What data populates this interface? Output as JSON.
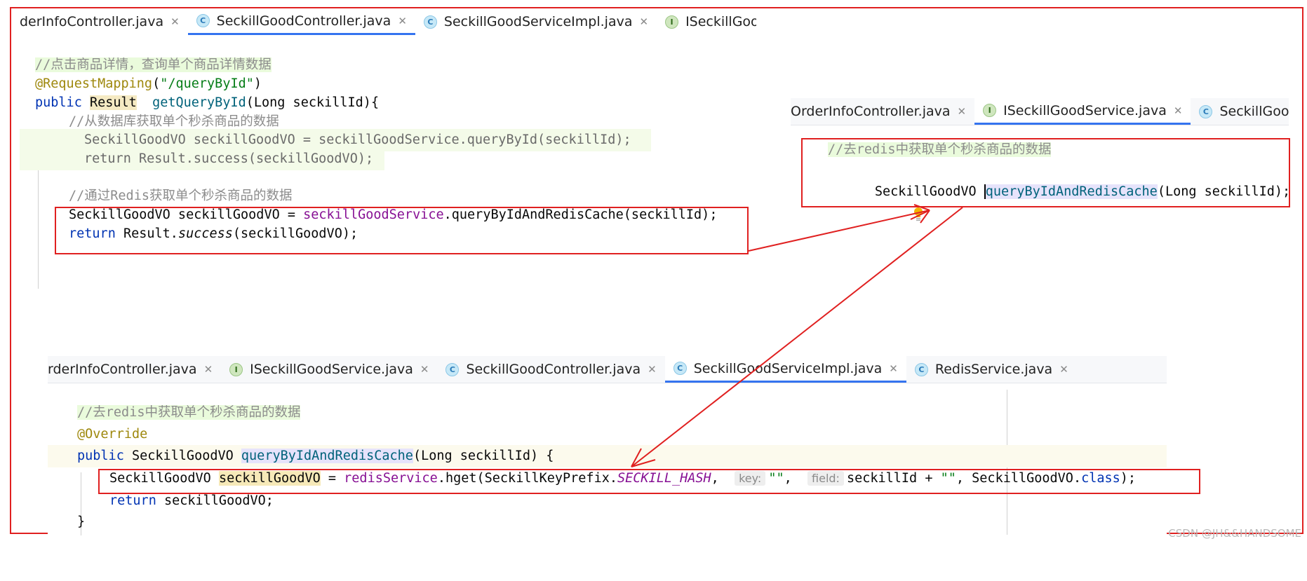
{
  "panel1": {
    "tabs": [
      {
        "label": "derInfoController.java",
        "icon": "class-icon",
        "active": false
      },
      {
        "label": "SeckillGoodController.java",
        "icon": "class-icon",
        "active": true
      },
      {
        "label": "SeckillGoodServiceImpl.java",
        "icon": "class-icon",
        "active": false
      },
      {
        "label": "ISeckillGoodService.j",
        "icon": "interface-icon",
        "active": false
      }
    ],
    "comment1": "//点击商品详情，查询单个商品详情数据",
    "annotation": "@RequestMapping",
    "mapping_path": "\"/queryById\"",
    "kw_public": "public",
    "type_result": "Result",
    "method_name": "getQueryById",
    "params": "(Long seckillId){",
    "comment2": "//从数据库获取单个秒杀商品的数据",
    "line_vo": "SeckillGoodVO seckillGoodVO = seckillGoodService.queryById(seckillId);",
    "line_return1": "return Result.success(seckillGoodVO);",
    "comment3": "//通过Redis获取单个秒杀商品的数据",
    "redis_call_prefix": "SeckillGoodVO seckillGoodVO = ",
    "redis_call_field": "seckillGoodService",
    "redis_call_suffix": ".queryByIdAndRedisCache(seckillId);",
    "kw_return": "return",
    "return_obj": " Result.",
    "return_method": "success",
    "return_args": "(seckillGoodVO);"
  },
  "panel2": {
    "tabs": [
      {
        "label": "OrderInfoController.java",
        "icon": "class-icon",
        "active": false
      },
      {
        "label": "ISeckillGoodService.java",
        "icon": "interface-icon",
        "active": true
      },
      {
        "label": "SeckillGoodContro",
        "icon": "class-icon",
        "active": false
      }
    ],
    "comment": "//去redis中获取单个秒杀商品的数据",
    "type": "SeckillGoodVO ",
    "method": "queryByIdAndRedisCache",
    "params": "(Long seckillId);"
  },
  "panel3": {
    "tabs": [
      {
        "label": "rderInfoController.java",
        "icon": "class-icon",
        "active": false
      },
      {
        "label": "ISeckillGoodService.java",
        "icon": "interface-icon",
        "active": false
      },
      {
        "label": "SeckillGoodController.java",
        "icon": "class-icon",
        "active": false
      },
      {
        "label": "SeckillGoodServiceImpl.java",
        "icon": "class-icon",
        "active": true
      },
      {
        "label": "RedisService.java",
        "icon": "class-icon",
        "active": false
      }
    ],
    "comment": "//去redis中获取单个秒杀商品的数据",
    "annotation": "@Override",
    "kw_public": "public",
    "decl_type": " SeckillGoodVO ",
    "method": "queryByIdAndRedisCache",
    "params": "(Long seckillId) {",
    "hget_type": "SeckillGoodVO ",
    "hget_var": "seckillGoodVO",
    "hget_eq": " = ",
    "hget_field": "redisService",
    "hget_call": ".hget(SeckillKeyPrefix.",
    "hget_const": "SECKILL_HASH",
    "hget_comma": ",  ",
    "hint_key": "key:",
    "str_empty1": "\"\"",
    "comma2": ",  ",
    "hint_field": "field:",
    "field_expr": "seckillId + ",
    "str_empty2": "\"\"",
    "class_ref": ", SeckillGoodVO.",
    "kw_class": "class",
    "close": ");",
    "return_kw": "return",
    "return_val": " seckillGoodVO;",
    "brace": "}"
  },
  "watermark": "CSDN @JH&&HANDSOME",
  "colors": {
    "annotation_box": "#e02020",
    "active_tab": "#3574f0",
    "comment": "#8c8c8c",
    "keyword": "#0033b3"
  }
}
